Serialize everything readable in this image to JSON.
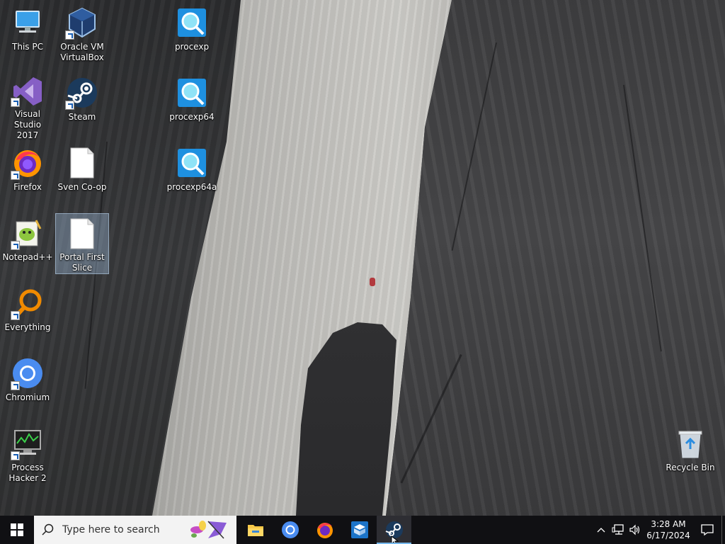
{
  "desktop": {
    "icons": [
      {
        "label": "This PC",
        "icon": "this-pc-icon"
      },
      {
        "label": "Oracle VM VirtualBox",
        "icon": "virtualbox-icon"
      },
      {
        "label": "procexp",
        "icon": "procexp-icon"
      },
      {
        "label": "Visual Studio 2017",
        "icon": "visual-studio-icon"
      },
      {
        "label": "Steam",
        "icon": "steam-icon"
      },
      {
        "label": "procexp64",
        "icon": "procexp-icon"
      },
      {
        "label": "Firefox",
        "icon": "firefox-icon"
      },
      {
        "label": "Sven Co-op",
        "icon": "file-icon"
      },
      {
        "label": "procexp64a",
        "icon": "procexp-icon"
      },
      {
        "label": "Notepad++",
        "icon": "notepadpp-icon"
      },
      {
        "label": "Portal First Slice",
        "icon": "file-icon",
        "selected": true
      },
      {
        "label": "Everything",
        "icon": "everything-icon"
      },
      {
        "label": "Chromium",
        "icon": "chromium-icon"
      },
      {
        "label": "Process Hacker 2",
        "icon": "process-hacker-icon"
      },
      {
        "label": "Recycle Bin",
        "icon": "recycle-bin-icon"
      }
    ]
  },
  "taskbar": {
    "search_placeholder": "Type here to search",
    "apps": [
      {
        "name": "File Explorer",
        "icon": "file-explorer-icon"
      },
      {
        "name": "Chromium",
        "icon": "chromium-icon"
      },
      {
        "name": "Firefox",
        "icon": "firefox-icon"
      },
      {
        "name": "VirtualBox",
        "icon": "virtualbox-icon"
      },
      {
        "name": "Steam",
        "icon": "steam-icon",
        "active": true
      }
    ],
    "tray": {
      "time": "3:28 AM",
      "date": "6/17/2024"
    }
  },
  "colors": {
    "taskbar_bg": "#101013",
    "active_app_underline": "#76b9ed",
    "search_bg": "#f3f3f3"
  }
}
